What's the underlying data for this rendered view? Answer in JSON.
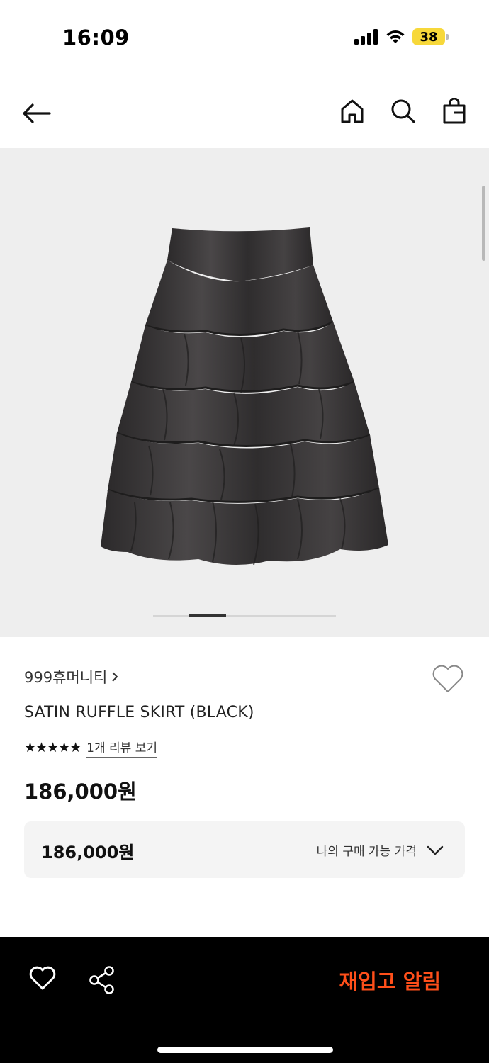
{
  "status": {
    "time": "16:09",
    "battery": "38"
  },
  "nav": {
    "back_icon": "arrow-left-icon",
    "home_icon": "home-icon",
    "search_icon": "search-icon",
    "bag_icon": "shopping-bag-icon"
  },
  "product": {
    "image_alt_icon": "skirt-image",
    "brand": "999휴머니티",
    "title": "SATIN RUFFLE SKIRT (BLACK)",
    "stars": "★★★★★",
    "review_link": "1개 리뷰 보기",
    "price": "186,000원",
    "price_box": {
      "value": "186,000원",
      "label": "나의 구매 가능 가격"
    }
  },
  "bottom_bar": {
    "restock_label": "재입고 알림"
  },
  "colors": {
    "accent": "#ff4f1a",
    "gallery_bg": "#eeeeee",
    "bottom_bg": "#000000"
  }
}
